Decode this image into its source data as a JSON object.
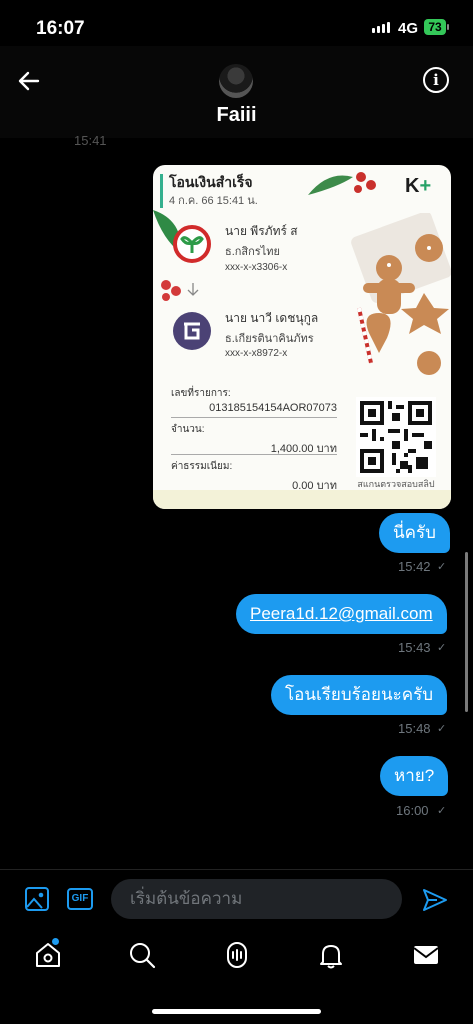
{
  "status_bar": {
    "time": "16:07",
    "network": "4G",
    "battery": "73"
  },
  "header": {
    "contact_name": "Faiii",
    "previous_time": "15:41"
  },
  "receipt": {
    "title": "โอนเงินสำเร็จ",
    "date": "4 ก.ค. 66  15:41 น.",
    "brand": "K",
    "brand_plus": "+",
    "sender": {
      "name": "นาย พีรภัทร์ ส",
      "bank": "ธ.กสิกรไทย",
      "account": "xxx-x-x3306-x"
    },
    "receiver": {
      "name": "นาย นาวี เดชนุกูล",
      "bank": "ธ.เกียรตินาคินภัทร",
      "account": "xxx-x-x8972-x"
    },
    "ref_label": "เลขที่รายการ:",
    "ref_value": "013185154154AOR07073",
    "amount_label": "จำนวน:",
    "amount_value": "1,400.00 บาท",
    "fee_label": "ค่าธรรมเนียม:",
    "fee_value": "0.00 บาท",
    "qr_caption": "สแกนตรวจสอบสลิป"
  },
  "messages": [
    {
      "text": "นี่ครับ",
      "time": "15:42"
    },
    {
      "text": "Peera1d.12@gmail.com",
      "time": "15:43"
    },
    {
      "text": "โอนเรียบร้อยนะครับ",
      "time": "15:48"
    },
    {
      "text": "หาย?",
      "time": "16:00"
    }
  ],
  "composer": {
    "placeholder": "เริ่มต้นข้อความ",
    "gif_label": "GIF"
  },
  "icons": [
    "back-arrow-icon",
    "info-icon",
    "image-icon",
    "gif-icon",
    "send-icon",
    "home-icon",
    "search-icon",
    "spaces-icon",
    "notifications-icon",
    "messages-icon"
  ],
  "colors": {
    "accent": "#1d9bf0",
    "background": "#000000",
    "input_bg": "#202327"
  }
}
